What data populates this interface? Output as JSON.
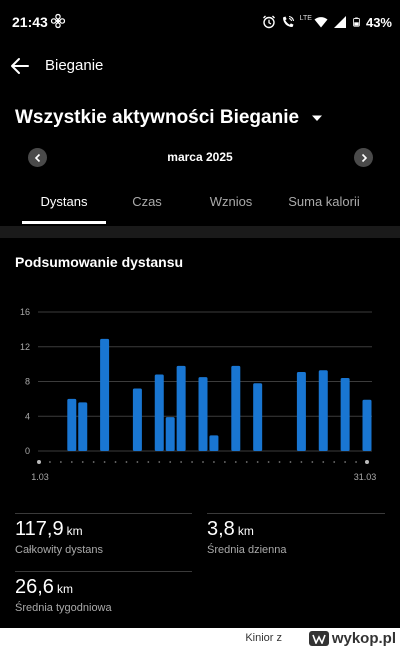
{
  "status_bar": {
    "time": "21:43",
    "battery": "43%",
    "network": "LTE",
    "icons": [
      "fan-icon",
      "alarm-icon",
      "wifi-call-icon",
      "wifi-icon",
      "signal-icon",
      "battery-icon"
    ]
  },
  "app_bar": {
    "title": "Bieganie",
    "back_icon": "arrow-left-icon"
  },
  "filter": {
    "label": "Wszystkie aktywności Bieganie",
    "icon": "caret-down-icon"
  },
  "month_nav": {
    "label": "marca 2025",
    "prev_icon": "chevron-left-icon",
    "next_icon": "chevron-right-icon"
  },
  "tabs": [
    {
      "label": "Dystans",
      "active": true
    },
    {
      "label": "Czas",
      "active": false
    },
    {
      "label": "Wznios",
      "active": false
    },
    {
      "label": "Suma kalorii",
      "active": false
    }
  ],
  "summary_title": "Podsumowanie dystansu",
  "chart_data": {
    "type": "bar",
    "x": [
      1,
      2,
      3,
      4,
      5,
      6,
      7,
      8,
      9,
      10,
      11,
      12,
      13,
      14,
      15,
      16,
      17,
      18,
      19,
      20,
      21,
      22,
      23,
      24,
      25,
      26,
      27,
      28,
      29,
      30,
      31
    ],
    "values": [
      0,
      0,
      0,
      6.0,
      5.6,
      0,
      12.9,
      0,
      0,
      7.2,
      0,
      8.8,
      3.9,
      9.8,
      0,
      8.5,
      1.8,
      0,
      9.8,
      0,
      7.8,
      0,
      0,
      0,
      9.1,
      0,
      9.3,
      0,
      8.4,
      0,
      5.9
    ],
    "ylim": [
      0,
      16
    ],
    "yticks": [
      "16",
      "12",
      "8",
      "4",
      "0"
    ],
    "xtick_start": "1.03",
    "xtick_end": "31.03",
    "grid": true,
    "bar_color": "#1976d2"
  },
  "stats": {
    "total": {
      "value": "117,9",
      "unit": "km",
      "label": "Całkowity dystans"
    },
    "daily": {
      "value": "3,8",
      "unit": "km",
      "label": "Średnia dzienna"
    },
    "weekly": {
      "value": "26,6",
      "unit": "km",
      "label": "Średnia tygodniowa"
    }
  },
  "footer": {
    "user": "Kinior z",
    "brand": "wykop.pl"
  }
}
